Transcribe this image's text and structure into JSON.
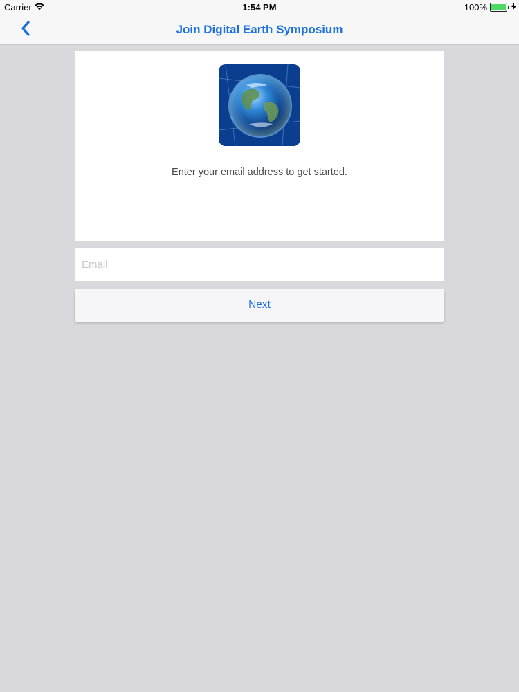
{
  "status_bar": {
    "carrier": "Carrier",
    "time": "1:54 PM",
    "battery": "100%",
    "battery_level": 1.0,
    "battery_color": "#4cd964",
    "wifi_icon": "wifi-icon",
    "charging_icon": "bolt-icon"
  },
  "nav": {
    "back_icon": "chevron-left-icon",
    "title": "Join Digital Earth Symposium",
    "accent_color": "#1a6fde"
  },
  "card": {
    "logo_icon": "globe-icon",
    "prompt": "Enter your email address to get started."
  },
  "form": {
    "email_placeholder": "Email",
    "email_value": "",
    "next_label": "Next"
  }
}
